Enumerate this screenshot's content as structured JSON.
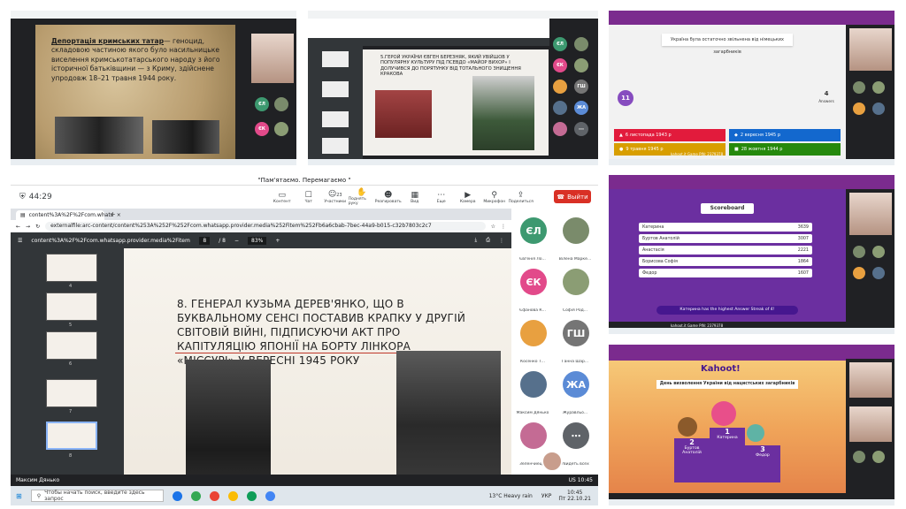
{
  "main": {
    "window_title": "\"Пам'ятаємо. Перемагаємо \"",
    "timer": "44:29",
    "toolbar": [
      {
        "label": "Контент",
        "icon": "content-icon"
      },
      {
        "label": "Чат",
        "icon": "chat-icon"
      },
      {
        "label": "Участники",
        "icon": "people-icon",
        "count": "23"
      },
      {
        "label": "Поднять руку",
        "icon": "hand-icon"
      },
      {
        "label": "Реагировать",
        "icon": "react-icon"
      },
      {
        "label": "Вид",
        "icon": "view-icon"
      },
      {
        "label": "Еще",
        "icon": "more-icon"
      },
      {
        "label": "Камера",
        "icon": "camera-icon"
      },
      {
        "label": "Микрофон",
        "icon": "mic-icon"
      },
      {
        "label": "Поделиться",
        "icon": "share-icon"
      }
    ],
    "leave_label": "Выйти",
    "tab_title": "content%3A%2F%2Fcom.whats",
    "url": "externalfile:arc-content/content%253A%252F%252Fcom.whatsapp.provider.media%252Fitem%252Fb6a6cbab-7bec-44a9-b015-c32b7803c2c7",
    "pdf_filename": "content%3A%2F%2Fcom.whatsapp.provider.media%2Fitem%2Fb6a6c...",
    "pdf_page": "8",
    "pdf_pages": "/ 8",
    "pdf_zoom": "83%",
    "thumb_numbers": [
      "4",
      "5",
      "6",
      "7",
      "8"
    ],
    "slide_title": "8. ГЕНЕРАЛ КУЗЬМА ДЕРЕВ'ЯНКО, ЩО В БУКВАЛЬНОМУ СЕНСІ ПОСТАВИВ КРАПКУ У ДРУГІЙ СВІТОВІЙ ВІЙНІ, ПІДПИСУЮЧИ АКТ ПРО КАПІТУЛЯЦІЮ ЯПОНІЇ НА БОРТУ ЛІНКОРА «МІССУРІ» У ВЕРЕСНІ 1945 РОКУ",
    "participants": [
      {
        "initials": "ЄЛ",
        "name": "Євгенія Ло...",
        "color": "#3d9970"
      },
      {
        "initials": "",
        "name": "Вілена Марке...",
        "color": "#7a8b6b"
      },
      {
        "initials": "ЄК",
        "name": "Єфанова К...",
        "color": "#e24a8a"
      },
      {
        "initials": "",
        "name": "Софія Род...",
        "color": "#8b9d74"
      },
      {
        "initials": "",
        "name": "Косенко Т...",
        "color": "#e8a040"
      },
      {
        "initials": "ГШ",
        "name": "Ганна Шар...",
        "color": "#757575"
      },
      {
        "initials": "",
        "name": "Максим Дянько",
        "color": "#56708c"
      },
      {
        "initials": "ЖА",
        "name": "Журавльо...",
        "color": "#5b8bd6"
      },
      {
        "initials": "",
        "name": "Зеленчиец...",
        "color": "#c46b94"
      },
      {
        "initials": "⋯",
        "name": "Увидеть всех",
        "color": "#5f6368"
      }
    ],
    "presenter_name": "Максим Дянько",
    "taskbar_search": "Чтобы начать поиск, введите здесь запрос",
    "weather": "13°C  Heavy rain",
    "lang": "УКР",
    "clock": "10:45",
    "date": "Пт 22.10.21",
    "net_info": "US  10:45"
  },
  "top_left": {
    "slide_heading": "Депортація кримських татар",
    "slide_body": "— геноцид, складовою частиною якого було насильницьке виселення кримськотатарського народу з його історичної батьківщини — з Криму, здійснене упродовж 18–21 травня 1944 року."
  },
  "top_middle": {
    "slide_title": "5.ГЕРОЙ УКРАЇНИ ЄВГЕН БЕРЕЗНЯК, ЯКИЙ УВІЙШОВ У ПОПУЛЯРНУ КУЛЬТУРУ ПІД ПСЕВДО «МАЙОР ВИХОР» І ДОЛУЧИВСЯ ДО ПОРЯТУНКУ ВІД ТОТАЛЬНОГО ЗНИЩЕННЯ КРАКОВА"
  },
  "top_right": {
    "question": "Україна була остаточно звільнена від німецьких загарбників",
    "timer": "11",
    "answers_count": "4",
    "answers_label": "Answers",
    "answers": [
      {
        "text": "6 листопада 1943 р",
        "color": "#e21b3c"
      },
      {
        "text": "2 вересня 1945 р",
        "color": "#1368ce"
      },
      {
        "text": "9 травня 1945 р",
        "color": "#d89e00"
      },
      {
        "text": "28 жовтня 1944 р",
        "color": "#26890c"
      }
    ],
    "footer": "kahoot.it  Game PIN: 2379378"
  },
  "mid_right": {
    "title": "Scoreboard",
    "rows": [
      {
        "name": "Катерина",
        "score": "3639"
      },
      {
        "name": "Буртов Анатолій",
        "score": "3007"
      },
      {
        "name": "Анастасія",
        "score": "2221"
      },
      {
        "name": "Борисова Софія",
        "score": "1864"
      },
      {
        "name": "Федор",
        "score": "1607"
      }
    ],
    "streak": "Катерина has the highest Answer Streak of 4!",
    "footer": "kahoot.it  Game PIN: 2379378"
  },
  "bottom_right": {
    "logo": "Kahoot!",
    "tagline": "День визволення України від нацистських загарбників",
    "podium": [
      {
        "place": "2",
        "name": "Буртов Анатолій"
      },
      {
        "place": "1",
        "name": "Катерина"
      },
      {
        "place": "3",
        "name": "Федор"
      }
    ]
  }
}
